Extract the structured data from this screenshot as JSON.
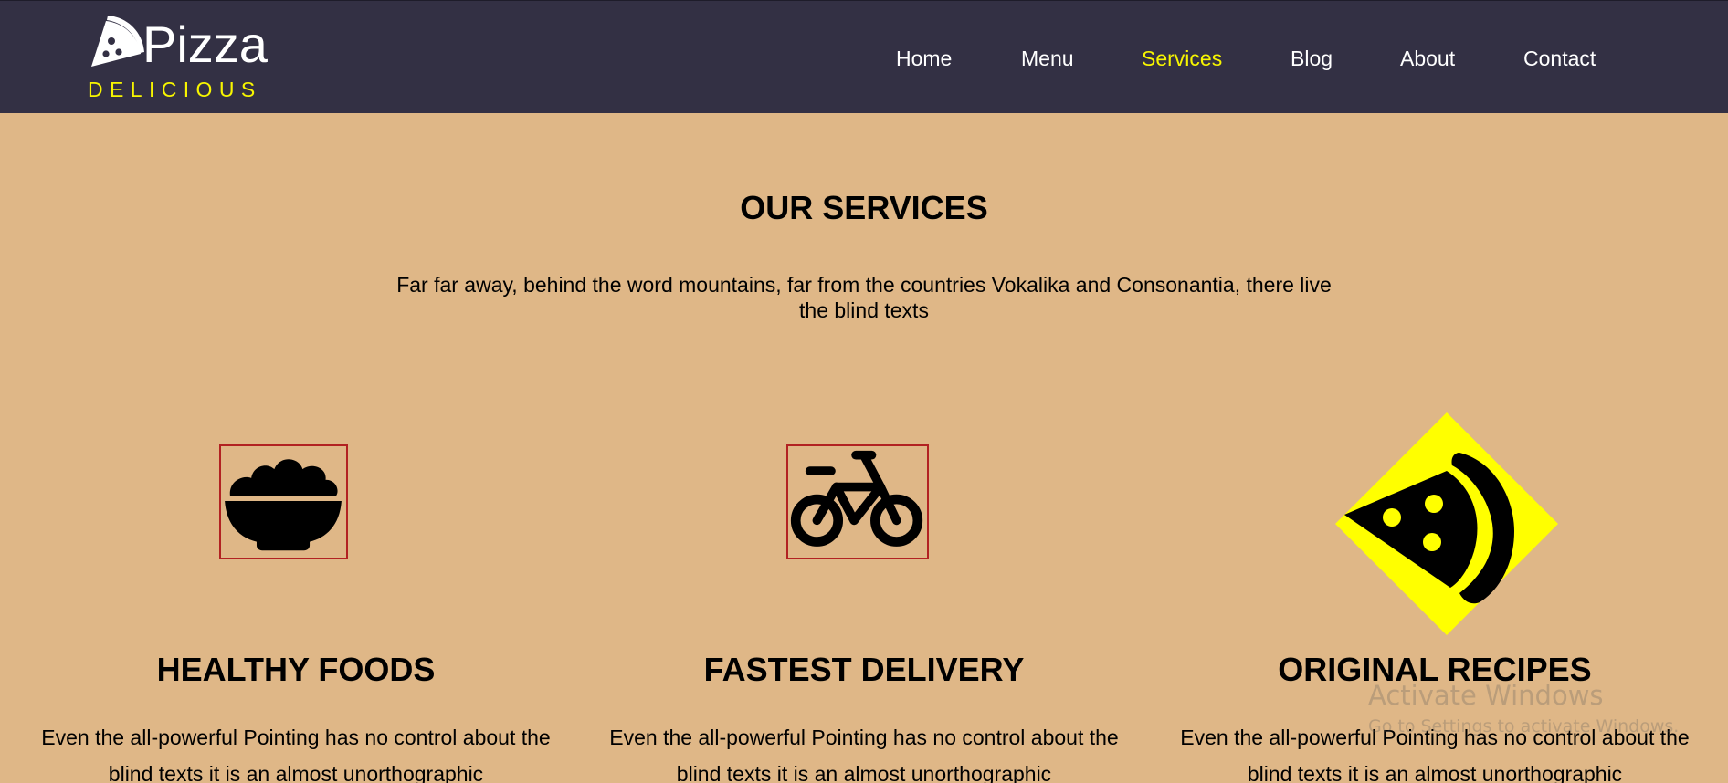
{
  "brand": {
    "title": "Pizza",
    "subtitle": "DELICIOUS"
  },
  "nav": {
    "items": [
      "Home",
      "Menu",
      "Services",
      "Blog",
      "About",
      "Contact"
    ],
    "active": "Services"
  },
  "services": {
    "title": "OUR SERVICES",
    "description": "Far far away, behind the word mountains, far from the countries Vokalika and Consonantia, there live the blind texts",
    "cards": [
      {
        "icon": "bowl-icon",
        "title": "HEALTHY FOODS",
        "text": "Even the all-powerful Pointing has no control about the blind texts it is an almost unorthographic"
      },
      {
        "icon": "bicycle-icon",
        "title": "FASTEST DELIVERY",
        "text": "Even the all-powerful Pointing has no control about the blind texts it is an almost unorthographic"
      },
      {
        "icon": "pizza-slice-icon",
        "title": "ORIGINAL RECIPES",
        "text": "Even the all-powerful Pointing has no control about the blind texts it is an almost unorthographic"
      }
    ]
  },
  "watermark": {
    "title": "Activate Windows",
    "subtitle": "Go to Settings to activate Windows."
  },
  "colors": {
    "header_bg": "#333044",
    "page_bg": "#dfb787",
    "accent": "#f7f500",
    "icon_border": "#b22222"
  }
}
